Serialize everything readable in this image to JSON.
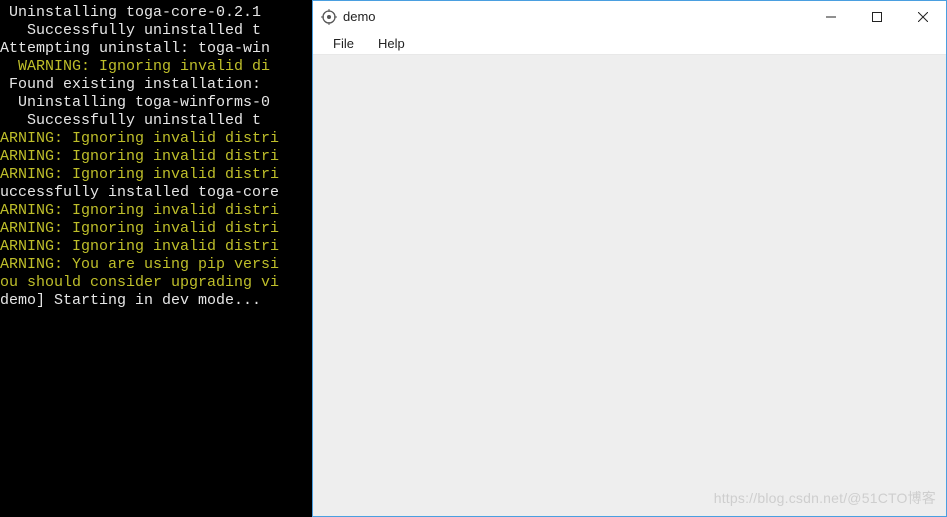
{
  "terminal": {
    "lines": [
      {
        "text": " Uninstalling toga-core-0.2.1",
        "cls": "c-white"
      },
      {
        "text": "   Successfully uninstalled t",
        "cls": "c-white"
      },
      {
        "text": "Attempting uninstall: toga-win",
        "cls": "c-white"
      },
      {
        "text": "  WARNING: Ignoring invalid di",
        "cls": "c-yellow"
      },
      {
        "text": " Found existing installation:",
        "cls": "c-white"
      },
      {
        "text": "  Uninstalling toga-winforms-0",
        "cls": "c-white"
      },
      {
        "text": "   Successfully uninstalled t",
        "cls": "c-white"
      },
      {
        "text": "ARNING: Ignoring invalid distri",
        "cls": "c-yellow"
      },
      {
        "text": "ARNING: Ignoring invalid distri",
        "cls": "c-yellow"
      },
      {
        "text": "ARNING: Ignoring invalid distri",
        "cls": "c-yellow"
      },
      {
        "text": "uccessfully installed toga-core",
        "cls": "c-white"
      },
      {
        "text": "ARNING: Ignoring invalid distri",
        "cls": "c-yellow"
      },
      {
        "text": "ARNING: Ignoring invalid distri",
        "cls": "c-yellow"
      },
      {
        "text": "ARNING: Ignoring invalid distri",
        "cls": "c-yellow"
      },
      {
        "text": "ARNING: You are using pip versi",
        "cls": "c-yellow"
      },
      {
        "text": "ou should consider upgrading vi",
        "cls": "c-yellow"
      },
      {
        "text": "",
        "cls": "c-white"
      },
      {
        "text": "demo] Starting in dev mode...",
        "cls": "c-white"
      }
    ]
  },
  "window": {
    "title": "demo",
    "menu": {
      "file": "File",
      "help": "Help"
    }
  },
  "watermark": "https://blog.csdn.net/@51CTO博客"
}
